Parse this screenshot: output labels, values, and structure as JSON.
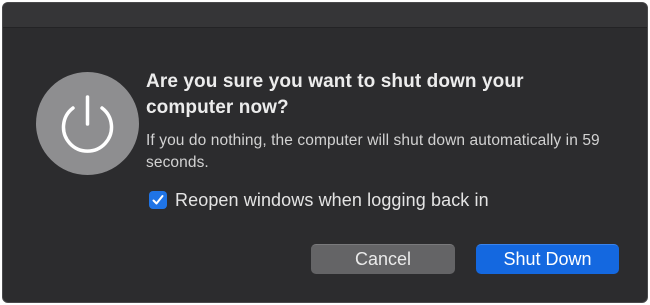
{
  "dialog": {
    "icon": "power-icon",
    "title": "Are you sure you want to shut down your computer now?",
    "message": "If you do nothing, the computer will shut down automatically in 59 seconds.",
    "checkbox": {
      "label": "Reopen windows when logging back in",
      "checked": true
    },
    "buttons": {
      "cancel": "Cancel",
      "confirm": "Shut Down"
    }
  },
  "colors": {
    "dialog_bg": "#2c2c2e",
    "accent": "#1468e0",
    "cancel_bg": "#646466"
  }
}
